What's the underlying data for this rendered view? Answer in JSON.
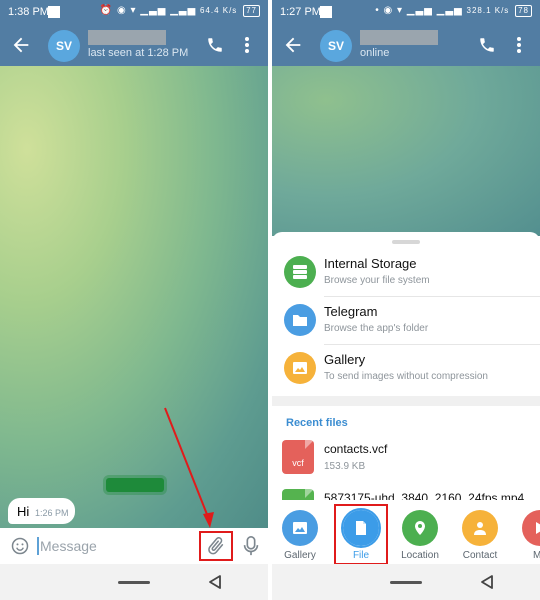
{
  "left": {
    "statusbar": {
      "time": "1:38 PM",
      "battery": "77",
      "net_speed": "64.4 K/s"
    },
    "header": {
      "avatar": "SV",
      "last_seen": "last seen at 1:28 PM"
    },
    "message": {
      "text": "Hi",
      "time": "1:26 PM"
    },
    "input": {
      "placeholder": "Message"
    }
  },
  "right": {
    "statusbar": {
      "time": "1:27 PM",
      "battery": "78",
      "net_speed": "328.1 K/s"
    },
    "header": {
      "avatar": "SV",
      "status": "online"
    },
    "sheet": {
      "options": [
        {
          "title": "Internal Storage",
          "subtitle": "Browse your file system",
          "color": "#4caf50",
          "icon": "storage-icon"
        },
        {
          "title": "Telegram",
          "subtitle": "Browse the app's folder",
          "color": "#4a9de2",
          "icon": "folder-icon"
        },
        {
          "title": "Gallery",
          "subtitle": "To send images without compression",
          "color": "#f6b23a",
          "icon": "image-icon"
        }
      ],
      "recent_header": "Recent files",
      "files": [
        {
          "name": "contacts.vcf",
          "size": "153.9 KB",
          "ext": "vcf",
          "color": "#e4615b"
        },
        {
          "name": "5873175-uhd_3840_2160_24fps.mp4",
          "size": "",
          "ext": "",
          "color": "#55b34f"
        }
      ]
    },
    "attach_menu": [
      {
        "label": "Gallery",
        "color": "#4a9de2",
        "icon": "gallery-icon"
      },
      {
        "label": "File",
        "color": "#3c9ce8",
        "icon": "file-icon"
      },
      {
        "label": "Location",
        "color": "#4caf50",
        "icon": "location-icon"
      },
      {
        "label": "Contact",
        "color": "#f6b23a",
        "icon": "contact-icon"
      },
      {
        "label": "Mu",
        "color": "#e4615b",
        "icon": "music-icon"
      }
    ]
  },
  "colors": {
    "header": "#527da3",
    "highlight": "#e01b1b",
    "accent": "#3b8dd1"
  }
}
